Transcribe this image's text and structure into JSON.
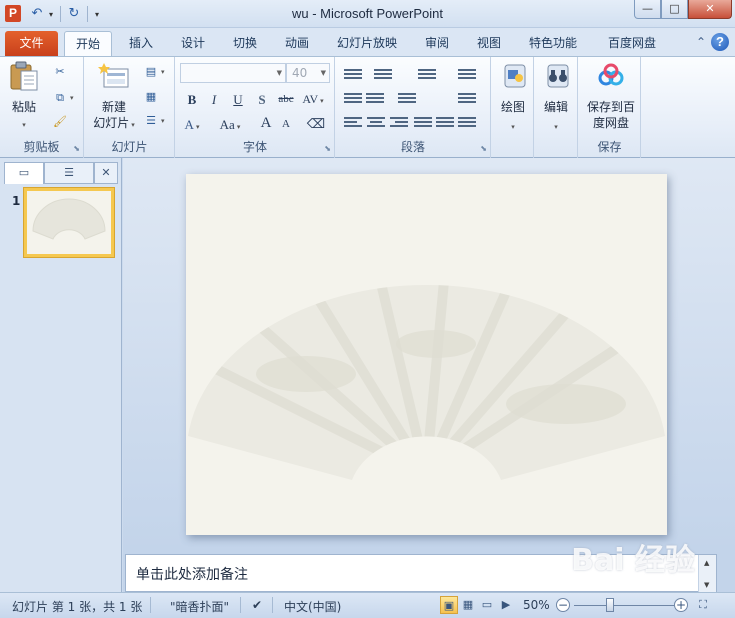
{
  "app": {
    "icon_letter": "P",
    "title": "wu  -  Microsoft PowerPoint"
  },
  "qat": {
    "save_icon": "save-icon",
    "undo_icon": "undo-icon",
    "redo_icon": "redo-icon",
    "customize_icon": "customize-icon"
  },
  "window": {
    "minimize": "—",
    "maximize": "□",
    "close": "✕"
  },
  "tabs": [
    "文件",
    "开始",
    "插入",
    "设计",
    "切换",
    "动画",
    "幻灯片放映",
    "审阅",
    "视图",
    "特色功能",
    "百度网盘"
  ],
  "active_tab": "开始",
  "help_label": "?",
  "ribbon": {
    "clipboard": {
      "label": "剪贴板",
      "paste": "粘贴"
    },
    "slides": {
      "label": "幻灯片",
      "new_slide_line1": "新建",
      "new_slide_line2": "幻灯片"
    },
    "font": {
      "label": "字体",
      "font_name": "",
      "font_size": "40",
      "bold": "B",
      "italic": "I",
      "underline": "U",
      "shadow": "S",
      "strike": "abc",
      "spacing": "AV",
      "case": "Aa",
      "grow": "A",
      "shrink": "A"
    },
    "paragraph": {
      "label": "段落"
    },
    "drawing": {
      "label": "绘图"
    },
    "editing": {
      "label": "编辑"
    },
    "save": {
      "group_label": "保存",
      "button_line1": "保存到百",
      "button_line2": "度网盘"
    }
  },
  "slides_panel": {
    "thumb_number": "1"
  },
  "notes": {
    "placeholder": "单击此处添加备注"
  },
  "status": {
    "slide_info": "幻灯片 第 1 张，共 1 张",
    "theme": "\"暗香扑面\"",
    "language": "中文(中国)",
    "zoom": "50%",
    "zoom_level": 0.36
  },
  "watermark": "Bai 经验"
}
